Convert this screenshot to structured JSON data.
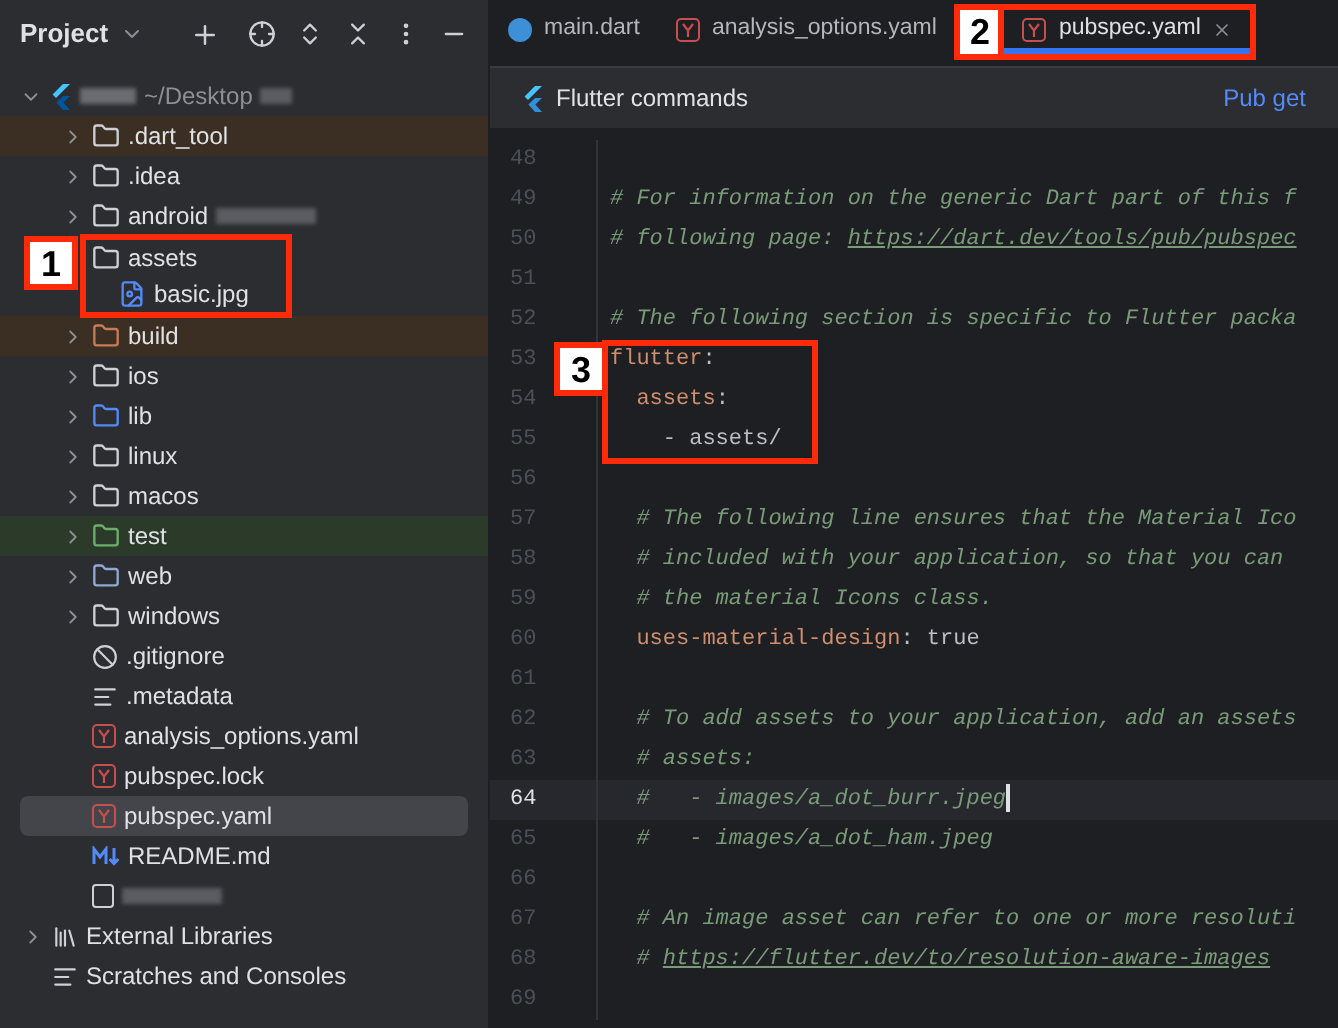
{
  "project_panel": {
    "title": "Project",
    "root": {
      "path": "~/Desktop",
      "expanded": true,
      "children": [
        {
          "name": ".dart_tool",
          "kind": "folder",
          "excluded": true,
          "selected": false
        },
        {
          "name": ".idea",
          "kind": "folder-config",
          "excluded": false,
          "selected": false
        },
        {
          "name": "android",
          "kind": "folder",
          "excluded": false,
          "selected": false,
          "redacted": true
        },
        {
          "name": "assets",
          "kind": "folder",
          "excluded": false,
          "selected": false,
          "annotation": "1",
          "children": [
            {
              "name": "basic.jpg",
              "kind": "image",
              "excluded": false,
              "selected": false
            }
          ]
        },
        {
          "name": "build",
          "kind": "folder-config-orange",
          "excluded": true,
          "selected": false
        },
        {
          "name": "ios",
          "kind": "folder",
          "excluded": false,
          "selected": false
        },
        {
          "name": "lib",
          "kind": "folder-source",
          "excluded": false,
          "selected": false
        },
        {
          "name": "linux",
          "kind": "folder",
          "excluded": false,
          "selected": false
        },
        {
          "name": "macos",
          "kind": "folder",
          "excluded": false,
          "selected": false
        },
        {
          "name": "test",
          "kind": "folder-test",
          "excluded": false,
          "selected": false
        },
        {
          "name": "web",
          "kind": "folder-web",
          "excluded": false,
          "selected": false
        },
        {
          "name": "windows",
          "kind": "folder",
          "excluded": false,
          "selected": false
        },
        {
          "name": ".gitignore",
          "kind": "ignore",
          "excluded": false,
          "selected": false
        },
        {
          "name": ".metadata",
          "kind": "text",
          "excluded": false,
          "selected": false
        },
        {
          "name": "analysis_options.yaml",
          "kind": "yaml",
          "excluded": false,
          "selected": false
        },
        {
          "name": "pubspec.lock",
          "kind": "yaml",
          "excluded": false,
          "selected": false
        },
        {
          "name": "pubspec.yaml",
          "kind": "yaml",
          "excluded": false,
          "selected": true
        },
        {
          "name": "README.md",
          "kind": "markdown",
          "excluded": false,
          "selected": false
        },
        {
          "kind": "blank",
          "excluded": false,
          "selected": false,
          "redacted": true
        }
      ]
    },
    "extras": [
      {
        "name": "External Libraries",
        "kind": "libraries"
      },
      {
        "name": "Scratches and Consoles",
        "kind": "scratches"
      }
    ]
  },
  "tabs": [
    {
      "label": "main.dart",
      "kind": "dart",
      "selected": false
    },
    {
      "label": "analysis_options.yaml",
      "kind": "yaml",
      "selected": false
    },
    {
      "label": "pubspec.yaml",
      "kind": "yaml",
      "selected": true,
      "annotation": "2"
    }
  ],
  "toolbar": {
    "title": "Flutter commands",
    "action": "Pub get"
  },
  "code_lines": [
    {
      "number": "48",
      "current": false
    },
    {
      "number": "49",
      "current": false,
      "segments": [
        {
          "kind": "comment",
          "text": "# For information on the generic Dart part of this f"
        }
      ]
    },
    {
      "number": "50",
      "current": false,
      "segments": [
        {
          "kind": "comment",
          "text": "# following page: "
        },
        {
          "kind": "link",
          "text": "https://dart.dev/tools/pub/pubspec"
        }
      ]
    },
    {
      "number": "51",
      "current": false
    },
    {
      "number": "52",
      "current": false,
      "segments": [
        {
          "kind": "comment",
          "text": "# The following section is specific to Flutter packa"
        }
      ]
    },
    {
      "number": "53",
      "current": false,
      "segments": [
        {
          "kind": "key",
          "text": "flutter"
        },
        {
          "kind": "plain",
          "text": ":"
        }
      ]
    },
    {
      "number": "54",
      "current": false,
      "segments": [
        {
          "kind": "key",
          "text": "  assets"
        },
        {
          "kind": "plain",
          "text": ":"
        }
      ]
    },
    {
      "number": "55",
      "current": false,
      "segments": [
        {
          "kind": "plain",
          "text": "    - assets/"
        }
      ]
    },
    {
      "number": "56",
      "current": false
    },
    {
      "number": "57",
      "current": false,
      "segments": [
        {
          "kind": "comment",
          "text": "  # The following line ensures that the Material Ico"
        }
      ]
    },
    {
      "number": "58",
      "current": false,
      "segments": [
        {
          "kind": "comment",
          "text": "  # included with your application, so that you can"
        }
      ]
    },
    {
      "number": "59",
      "current": false,
      "segments": [
        {
          "kind": "comment",
          "text": "  # the material Icons class."
        }
      ]
    },
    {
      "number": "60",
      "current": false,
      "segments": [
        {
          "kind": "key",
          "text": "  uses-material-design"
        },
        {
          "kind": "plain",
          "text": ": true"
        }
      ]
    },
    {
      "number": "61",
      "current": false
    },
    {
      "number": "62",
      "current": false,
      "segments": [
        {
          "kind": "comment",
          "text": "  # To add assets to your application, add an assets"
        }
      ]
    },
    {
      "number": "63",
      "current": false,
      "segments": [
        {
          "kind": "comment",
          "text": "  # assets:"
        }
      ]
    },
    {
      "number": "64",
      "current": true,
      "segments": [
        {
          "kind": "comment",
          "text": "  #   - images/a_dot_burr.jpeg"
        }
      ]
    },
    {
      "number": "65",
      "current": false,
      "segments": [
        {
          "kind": "comment",
          "text": "  #   - images/a_dot_ham.jpeg"
        }
      ]
    },
    {
      "number": "66",
      "current": false
    },
    {
      "number": "67",
      "current": false,
      "segments": [
        {
          "kind": "comment",
          "text": "  # An image asset can refer to one or more resoluti"
        }
      ]
    },
    {
      "number": "68",
      "current": false,
      "segments": [
        {
          "kind": "comment",
          "text": "  # "
        },
        {
          "kind": "link",
          "text": "https://flutter.dev/to/resolution-aware-images"
        }
      ]
    },
    {
      "number": "69",
      "current": false
    }
  ],
  "annotations": [
    {
      "label": "3"
    }
  ]
}
